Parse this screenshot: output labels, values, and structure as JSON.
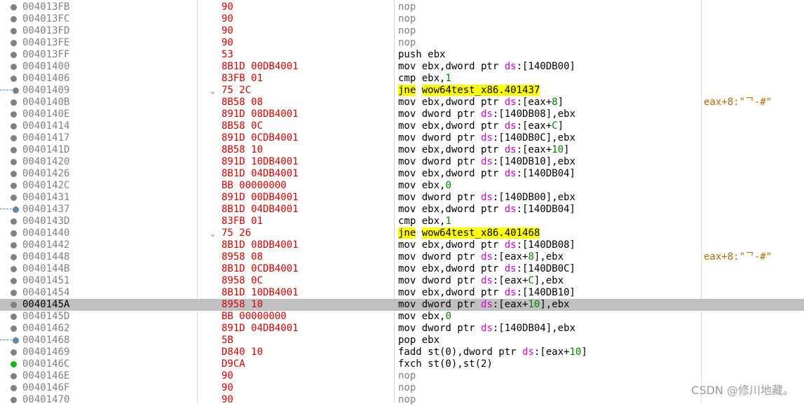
{
  "window": {
    "accent_selection": "#c0c0c0",
    "bytes_color": "#d40000",
    "address_color": "#808080",
    "highlight_color": "#ffff00"
  },
  "rows": [
    {
      "address": "004013FB",
      "bytes": "90",
      "asm": [
        {
          "t": "nop",
          "c": "nop"
        }
      ],
      "comment": "",
      "marker": "dot"
    },
    {
      "address": "004013FC",
      "bytes": "90",
      "asm": [
        {
          "t": "nop",
          "c": "nop"
        }
      ],
      "comment": "",
      "marker": "dot"
    },
    {
      "address": "004013FD",
      "bytes": "90",
      "asm": [
        {
          "t": "nop",
          "c": "nop"
        }
      ],
      "comment": "",
      "marker": "dot"
    },
    {
      "address": "004013FE",
      "bytes": "90",
      "asm": [
        {
          "t": "nop",
          "c": "nop"
        }
      ],
      "comment": "",
      "marker": "dot"
    },
    {
      "address": "004013FF",
      "bytes": "53",
      "asm": [
        {
          "t": "push ebx"
        }
      ],
      "comment": "",
      "marker": "dot"
    },
    {
      "address": "00401400",
      "bytes": "8B1D 00DB4001",
      "asm": [
        {
          "t": "mov ebx,dword ptr "
        },
        {
          "t": "ds",
          "c": "seg"
        },
        {
          "t": ":[140DB00]"
        }
      ],
      "comment": "",
      "marker": "dot"
    },
    {
      "address": "00401406",
      "bytes": "83FB 01",
      "asm": [
        {
          "t": "cmp ebx,"
        },
        {
          "t": "1",
          "c": "num"
        }
      ],
      "comment": "",
      "marker": "dot"
    },
    {
      "address": "00401409",
      "bytes": "75 2C",
      "asm": [
        {
          "t": "jne",
          "c": "hl"
        },
        {
          "t": " "
        },
        {
          "t": "wow64test_x86.401437",
          "c": "hl"
        }
      ],
      "comment": "",
      "marker": "arrow-in",
      "jump": "⌄"
    },
    {
      "address": "0040140B",
      "bytes": "8B58 08",
      "asm": [
        {
          "t": "mov ebx,dword ptr "
        },
        {
          "t": "ds",
          "c": "seg"
        },
        {
          "t": ":[eax+"
        },
        {
          "t": "8",
          "c": "num"
        },
        {
          "t": "]"
        }
      ],
      "comment": "eax+8:\"ᄀ-#\"",
      "marker": "dot"
    },
    {
      "address": "0040140E",
      "bytes": "891D 08DB4001",
      "asm": [
        {
          "t": "mov dword ptr "
        },
        {
          "t": "ds",
          "c": "seg"
        },
        {
          "t": ":[140DB08],ebx"
        }
      ],
      "comment": "",
      "marker": "dot"
    },
    {
      "address": "00401414",
      "bytes": "8B58 0C",
      "asm": [
        {
          "t": "mov ebx,dword ptr "
        },
        {
          "t": "ds",
          "c": "seg"
        },
        {
          "t": ":[eax+"
        },
        {
          "t": "C",
          "c": "num"
        },
        {
          "t": "]"
        }
      ],
      "comment": "",
      "marker": "dot"
    },
    {
      "address": "00401417",
      "bytes": "891D 0CDB4001",
      "asm": [
        {
          "t": "mov dword ptr "
        },
        {
          "t": "ds",
          "c": "seg"
        },
        {
          "t": ":[140DB0C],ebx"
        }
      ],
      "comment": "",
      "marker": "dot"
    },
    {
      "address": "0040141D",
      "bytes": "8B58 10",
      "asm": [
        {
          "t": "mov ebx,dword ptr "
        },
        {
          "t": "ds",
          "c": "seg"
        },
        {
          "t": ":[eax+"
        },
        {
          "t": "10",
          "c": "num"
        },
        {
          "t": "]"
        }
      ],
      "comment": "",
      "marker": "dot"
    },
    {
      "address": "00401420",
      "bytes": "891D 10DB4001",
      "asm": [
        {
          "t": "mov dword ptr "
        },
        {
          "t": "ds",
          "c": "seg"
        },
        {
          "t": ":[140DB10],ebx"
        }
      ],
      "comment": "",
      "marker": "dot"
    },
    {
      "address": "00401426",
      "bytes": "8B1D 04DB4001",
      "asm": [
        {
          "t": "mov ebx,dword ptr "
        },
        {
          "t": "ds",
          "c": "seg"
        },
        {
          "t": ":[140DB04]"
        }
      ],
      "comment": "",
      "marker": "dot"
    },
    {
      "address": "0040142C",
      "bytes": "BB 00000000",
      "asm": [
        {
          "t": "mov ebx,"
        },
        {
          "t": "0",
          "c": "num"
        }
      ],
      "comment": "",
      "marker": "dot"
    },
    {
      "address": "00401431",
      "bytes": "891D 00DB4001",
      "asm": [
        {
          "t": "mov dword ptr "
        },
        {
          "t": "ds",
          "c": "seg"
        },
        {
          "t": ":[140DB00],ebx"
        }
      ],
      "comment": "",
      "marker": "dot"
    },
    {
      "address": "00401437",
      "bytes": "8B1D 04DB4001",
      "asm": [
        {
          "t": "mov ebx,dword ptr "
        },
        {
          "t": "ds",
          "c": "seg"
        },
        {
          "t": ":[140DB04]"
        }
      ],
      "comment": "",
      "marker": "arrow-target"
    },
    {
      "address": "0040143D",
      "bytes": "83FB 01",
      "asm": [
        {
          "t": "cmp ebx,"
        },
        {
          "t": "1",
          "c": "num"
        }
      ],
      "comment": "",
      "marker": "dot"
    },
    {
      "address": "00401440",
      "bytes": "75 26",
      "asm": [
        {
          "t": "jne",
          "c": "hl"
        },
        {
          "t": " "
        },
        {
          "t": "wow64test_x86.401468",
          "c": "hl"
        }
      ],
      "comment": "",
      "marker": "dot",
      "jump": "⌄"
    },
    {
      "address": "00401442",
      "bytes": "8B1D 08DB4001",
      "asm": [
        {
          "t": "mov ebx,dword ptr "
        },
        {
          "t": "ds",
          "c": "seg"
        },
        {
          "t": ":[140DB08]"
        }
      ],
      "comment": "",
      "marker": "dot"
    },
    {
      "address": "00401448",
      "bytes": "8958 08",
      "asm": [
        {
          "t": "mov dword ptr "
        },
        {
          "t": "ds",
          "c": "seg"
        },
        {
          "t": ":[eax+"
        },
        {
          "t": "8",
          "c": "num"
        },
        {
          "t": "],ebx"
        }
      ],
      "comment": "eax+8:\"ᄀ-#\"",
      "marker": "dot"
    },
    {
      "address": "0040144B",
      "bytes": "8B1D 0CDB4001",
      "asm": [
        {
          "t": "mov ebx,dword ptr "
        },
        {
          "t": "ds",
          "c": "seg"
        },
        {
          "t": ":[140DB0C]"
        }
      ],
      "comment": "",
      "marker": "dot"
    },
    {
      "address": "00401451",
      "bytes": "8958 0C",
      "asm": [
        {
          "t": "mov dword ptr "
        },
        {
          "t": "ds",
          "c": "seg"
        },
        {
          "t": ":[eax+"
        },
        {
          "t": "C",
          "c": "num"
        },
        {
          "t": "],ebx"
        }
      ],
      "comment": "",
      "marker": "dot"
    },
    {
      "address": "00401454",
      "bytes": "8B1D 10DB4001",
      "asm": [
        {
          "t": "mov ebx,dword ptr "
        },
        {
          "t": "ds",
          "c": "seg"
        },
        {
          "t": ":[140DB10]"
        }
      ],
      "comment": "",
      "marker": "dot"
    },
    {
      "address": "0040145A",
      "bytes": "8958 10",
      "asm": [
        {
          "t": "mov dword ptr "
        },
        {
          "t": "ds",
          "c": "seg"
        },
        {
          "t": ":[eax+"
        },
        {
          "t": "10",
          "c": "num"
        },
        {
          "t": "],ebx"
        }
      ],
      "comment": "",
      "marker": "dot",
      "selected": true
    },
    {
      "address": "0040145D",
      "bytes": "BB 00000000",
      "asm": [
        {
          "t": "mov ebx,"
        },
        {
          "t": "0",
          "c": "num"
        }
      ],
      "comment": "",
      "marker": "dot"
    },
    {
      "address": "00401462",
      "bytes": "891D 04DB4001",
      "asm": [
        {
          "t": "mov dword ptr "
        },
        {
          "t": "ds",
          "c": "seg"
        },
        {
          "t": ":[140DB04],ebx"
        }
      ],
      "comment": "",
      "marker": "dot"
    },
    {
      "address": "00401468",
      "bytes": "5B",
      "asm": [
        {
          "t": "pop ebx"
        }
      ],
      "comment": "",
      "marker": "arrow-target"
    },
    {
      "address": "00401469",
      "bytes": "D840 10",
      "asm": [
        {
          "t": "fadd st(0),dword ptr "
        },
        {
          "t": "ds",
          "c": "seg"
        },
        {
          "t": ":[eax+"
        },
        {
          "t": "10",
          "c": "num"
        },
        {
          "t": "]"
        }
      ],
      "comment": "",
      "marker": "dot"
    },
    {
      "address": "0040146C",
      "bytes": "D9CA",
      "asm": [
        {
          "t": "fxch st(0),st(2)"
        }
      ],
      "comment": "",
      "marker": "breakpoint"
    },
    {
      "address": "0040146E",
      "bytes": "90",
      "asm": [
        {
          "t": "nop",
          "c": "nop"
        }
      ],
      "comment": "",
      "marker": "dot"
    },
    {
      "address": "0040146F",
      "bytes": "90",
      "asm": [
        {
          "t": "nop",
          "c": "nop"
        }
      ],
      "comment": "",
      "marker": "dot"
    },
    {
      "address": "00401470",
      "bytes": "90",
      "asm": [
        {
          "t": "nop",
          "c": "nop"
        }
      ],
      "comment": "",
      "marker": "dot"
    }
  ],
  "watermark": "CSDN @修川地藏。"
}
